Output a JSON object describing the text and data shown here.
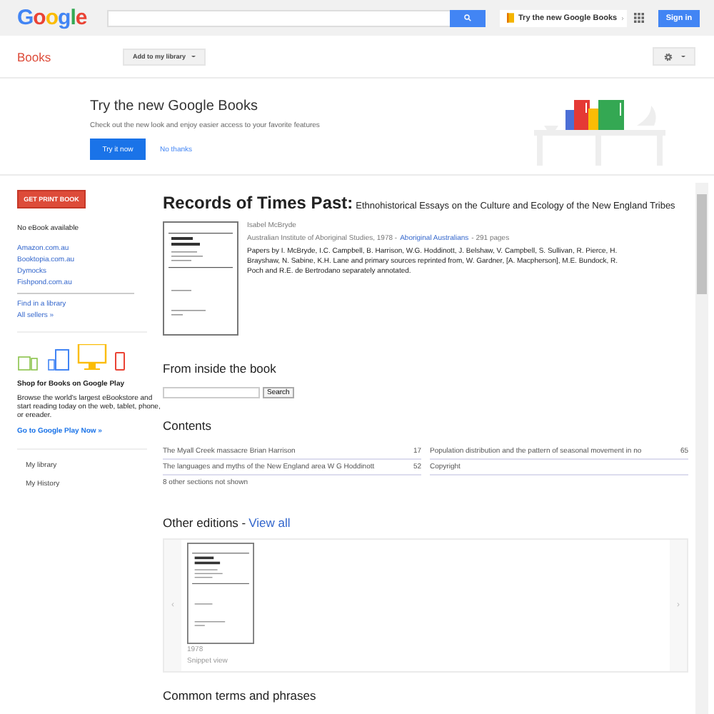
{
  "header": {
    "logo": "Google",
    "promo_link": "Try the new Google Books",
    "sign_in": "Sign in"
  },
  "toolbar": {
    "section": "Books",
    "add_button": "Add to my library"
  },
  "promo": {
    "title": "Try the new Google Books",
    "text": "Check out the new look and enjoy easier access to your favorite features",
    "primary": "Try it now",
    "secondary": "No thanks"
  },
  "sidebar": {
    "get_print": "GET PRINT BOOK",
    "no_ebook": "No eBook available",
    "sellers": [
      "Amazon.com.au",
      "Booktopia.com.au",
      "Dymocks",
      "Fishpond.com.au"
    ],
    "library_links": [
      "Find in a library",
      "All sellers »"
    ],
    "play": {
      "title": "Shop for Books on Google Play",
      "text": "Browse the world's largest eBookstore and start reading today on the web, tablet, phone, or ereader.",
      "link": "Go to Google Play Now »"
    },
    "nav": [
      "My library",
      "My History"
    ]
  },
  "book": {
    "title": "Records of Times Past:",
    "subtitle": "Ethnohistorical Essays on the Culture and Ecology of the New England Tribes",
    "author": "Isabel McBryde",
    "publisher": "Australian Institute of Aboriginal Studies, 1978 -",
    "subject": "Aboriginal Australians",
    "pages": "- 291 pages",
    "description": "Papers by I. McBryde, I.C. Campbell, B. Harrison, W.G. Hoddinott, J. Belshaw, V. Campbell, S. Sullivan, R. Pierce, H. Brayshaw, N. Sabine, K.H. Lane and primary sources reprinted from, W. Gardner, [A. Macpherson], M.E. Bundock, R. Poch and R.E. de Bertrodano separately annotated."
  },
  "inside": {
    "heading": "From inside the book",
    "search_button": "Search"
  },
  "contents": {
    "heading": "Contents",
    "rows": [
      {
        "title": "The Myall Creek massacre Brian Harrison",
        "page": "17"
      },
      {
        "title": "Population distribution and the pattern of seasonal movement in no",
        "page": "65"
      },
      {
        "title": "The languages and myths of the New England area W G Hoddinott",
        "page": "52"
      },
      {
        "title": "Copyright"
      }
    ],
    "note": "8 other sections not shown"
  },
  "editions": {
    "heading": "Other editions -",
    "view_all": "View all",
    "items": [
      {
        "year": "1978",
        "view": "Snippet view"
      }
    ],
    "prev": "‹",
    "next": "›"
  },
  "common_terms": {
    "heading": "Common terms and phrases"
  }
}
